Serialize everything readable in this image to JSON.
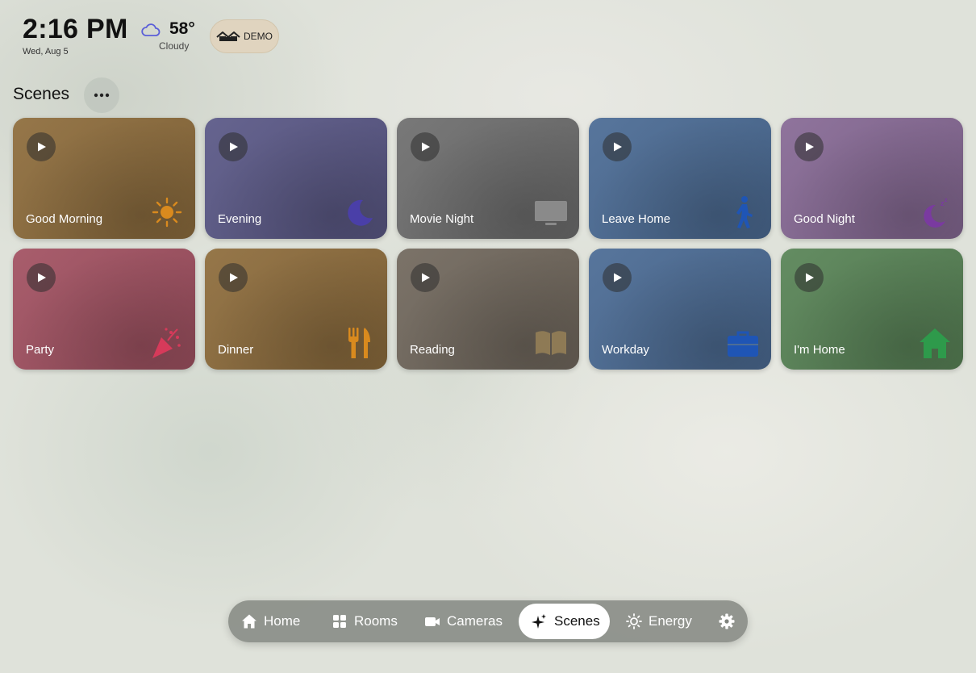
{
  "header": {
    "time": "2:16 PM",
    "date": "Wed, Aug 5",
    "weather": {
      "temperature": "58°",
      "condition": "Cloudy",
      "icon": "cloud-icon"
    },
    "badge": {
      "label": "DEMO",
      "icon": "houses-icon"
    }
  },
  "section": {
    "title": "Scenes",
    "menu_icon": "more-horizontal-icon"
  },
  "scenes": [
    {
      "label": "Good Morning",
      "icon": "sun-icon",
      "color": "#8f6e3e"
    },
    {
      "label": "Evening",
      "icon": "moon-icon",
      "color": "#5c5a88"
    },
    {
      "label": "Movie Night",
      "icon": "tv-icon",
      "color": "#707070"
    },
    {
      "label": "Leave Home",
      "icon": "walking-person-icon",
      "color": "#4d6d96"
    },
    {
      "label": "Good Night",
      "icon": "moon-sleep-icon",
      "color": "#886b96"
    },
    {
      "label": "Party",
      "icon": "party-popper-icon",
      "color": "#a35363"
    },
    {
      "label": "Dinner",
      "icon": "fork-knife-icon",
      "color": "#8f6e3e"
    },
    {
      "label": "Reading",
      "icon": "book-icon",
      "color": "#736a5f"
    },
    {
      "label": "Workday",
      "icon": "briefcase-icon",
      "color": "#4d6d96"
    },
    {
      "label": "I'm Home",
      "icon": "house-icon",
      "color": "#5a8558"
    }
  ],
  "nav": {
    "items": [
      {
        "label": "Home",
        "icon": "house-icon"
      },
      {
        "label": "Rooms",
        "icon": "grid-icon"
      },
      {
        "label": "Cameras",
        "icon": "video-camera-icon"
      },
      {
        "label": "Scenes",
        "icon": "sparkles-icon",
        "active": true
      },
      {
        "label": "Energy",
        "icon": "sun-icon"
      },
      {
        "label": "",
        "icon": "gear-icon"
      }
    ]
  }
}
